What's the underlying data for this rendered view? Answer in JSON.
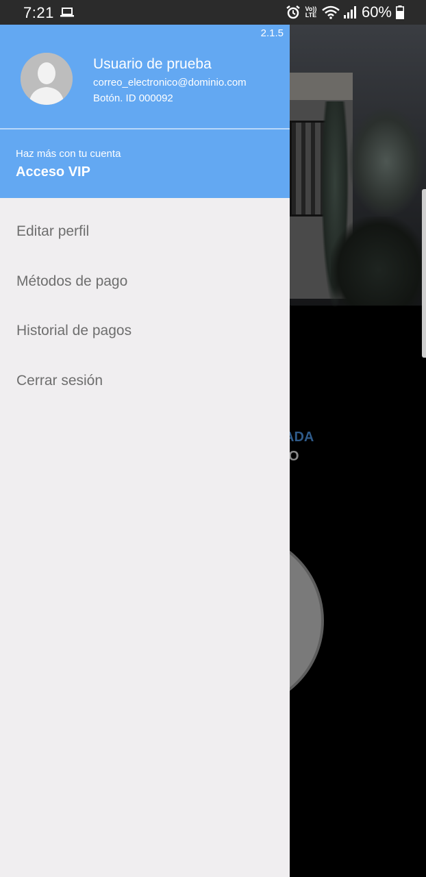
{
  "status_bar": {
    "time": "7:21",
    "volte_line1": "Vo))",
    "volte_line2": "LTE",
    "battery": "60%",
    "icons": [
      "laptop-icon",
      "alarm-icon",
      "volte-icon",
      "wifi-icon",
      "signal-icon",
      "battery-icon"
    ]
  },
  "drawer": {
    "version": "2.1.5",
    "user": {
      "name": "Usuario de prueba",
      "email": "correo_electronico@dominio.com",
      "id_text": "Botón. ID 000092"
    },
    "vip": {
      "subtitle": "Haz más con tu cuenta",
      "title": "Acceso VIP"
    },
    "menu": [
      {
        "label": "Editar perfil"
      },
      {
        "label": "Métodos de pago"
      },
      {
        "label": "Historial de pagos"
      },
      {
        "label": "Cerrar sesión"
      }
    ],
    "colors": {
      "header": "#63a8f2",
      "body": "#f0eef0",
      "menu_text": "#6e6e6e"
    }
  },
  "background_app": {
    "text_line1": "ADA",
    "text_line2": "O"
  }
}
